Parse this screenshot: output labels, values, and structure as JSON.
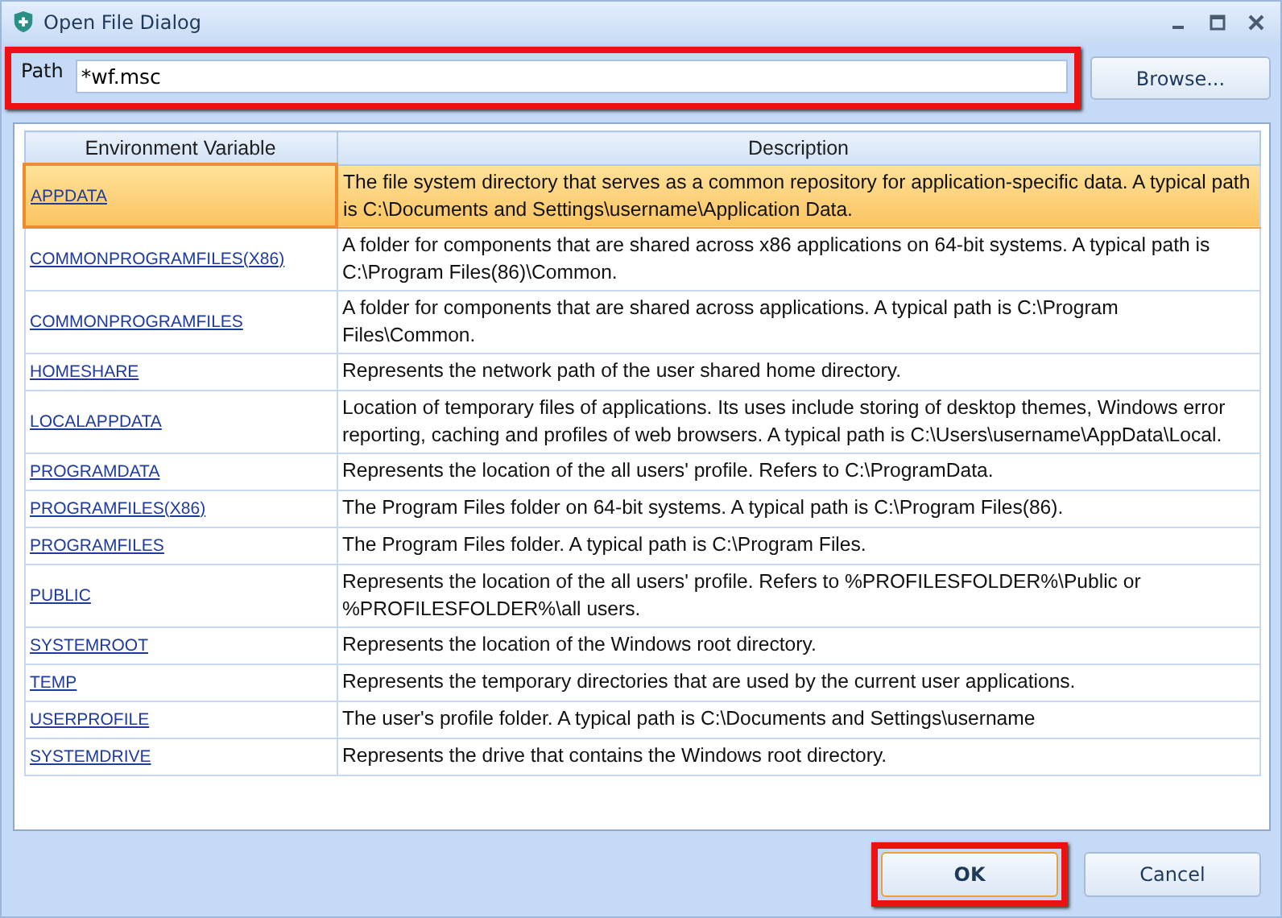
{
  "window": {
    "title": "Open File Dialog"
  },
  "path": {
    "label": "Path",
    "value": "*wf.msc",
    "highlighted": true
  },
  "browse_button": {
    "label": "Browse..."
  },
  "table": {
    "columns": [
      "Environment Variable",
      "Description"
    ],
    "rows": [
      {
        "name": "APPDATA",
        "description": "The file system directory that serves as a common repository for application-specific data. A typical path is C:\\Documents and Settings\\username\\Application Data.",
        "selected": true
      },
      {
        "name": "COMMONPROGRAMFILES(X86)",
        "description": "A folder for components that are shared across x86 applications on 64-bit systems. A typical path is C:\\Program Files(86)\\Common.",
        "selected": false
      },
      {
        "name": "COMMONPROGRAMFILES",
        "description": " A folder for components that are shared across applications. A typical path is C:\\Program Files\\Common.",
        "selected": false
      },
      {
        "name": "HOMESHARE",
        "description": "Represents the network path of the user shared home directory.",
        "selected": false
      },
      {
        "name": "LOCALAPPDATA",
        "description": "Location of temporary files of applications. Its uses include storing of desktop themes, Windows error reporting, caching and profiles of web browsers. A typical path is C:\\Users\\username\\AppData\\Local.",
        "selected": false
      },
      {
        "name": "PROGRAMDATA",
        "description": "Represents the location of the all users' profile. Refers to C:\\ProgramData.",
        "selected": false
      },
      {
        "name": "PROGRAMFILES(X86)",
        "description": "The Program Files folder on 64-bit systems. A typical path is C:\\Program Files(86).",
        "selected": false
      },
      {
        "name": "PROGRAMFILES",
        "description": "The Program Files folder. A typical path is C:\\Program Files.",
        "selected": false
      },
      {
        "name": "PUBLIC",
        "description": "Represents the location of the all users' profile. Refers to %PROFILESFOLDER%\\Public or %PROFILESFOLDER%\\all users.",
        "selected": false
      },
      {
        "name": "SYSTEMROOT",
        "description": "Represents the location of the Windows root directory.",
        "selected": false
      },
      {
        "name": "TEMP",
        "description": "Represents the temporary directories that are used by the current user applications.",
        "selected": false
      },
      {
        "name": "USERPROFILE",
        "description": "The user's profile folder. A typical path is C:\\Documents and Settings\\username",
        "selected": false
      },
      {
        "name": "SYSTEMDRIVE",
        "description": "Represents the drive that contains the Windows root directory.",
        "selected": false
      }
    ]
  },
  "buttons": [
    {
      "label": "OK",
      "default": true,
      "highlighted": true
    },
    {
      "label": "Cancel",
      "default": false,
      "highlighted": false
    }
  ]
}
